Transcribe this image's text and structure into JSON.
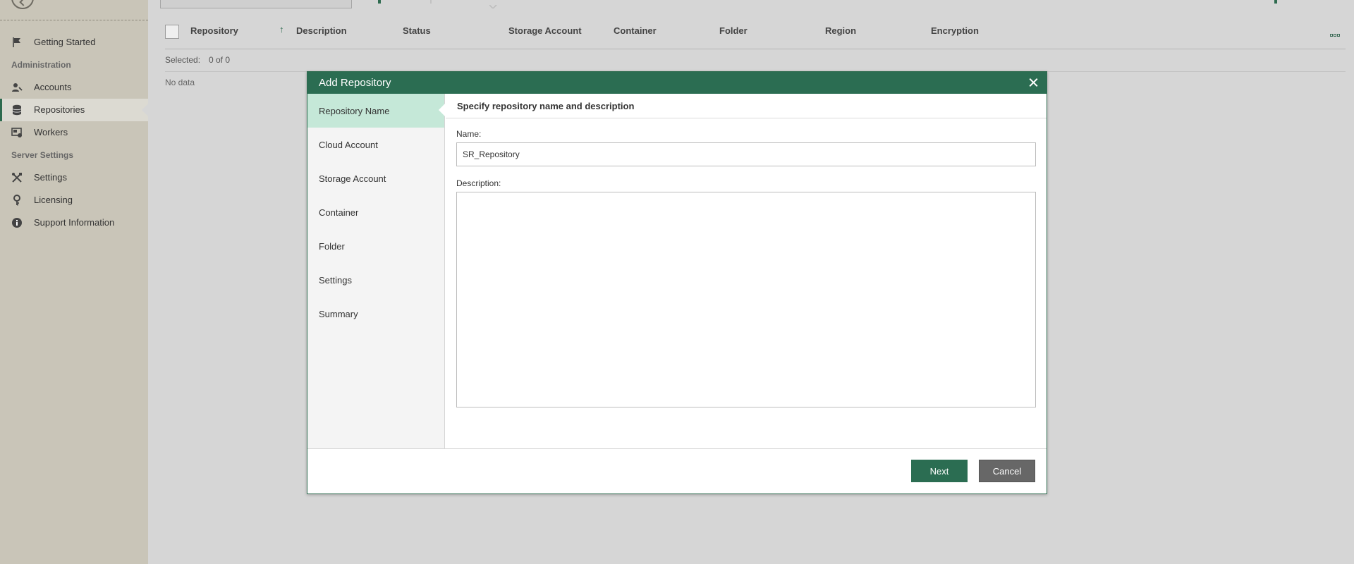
{
  "sidebar": {
    "items": [
      {
        "label": "Getting Started",
        "icon": "flag-icon"
      },
      {
        "label": "Accounts",
        "icon": "accounts-icon"
      },
      {
        "label": "Repositories",
        "icon": "database-icon"
      },
      {
        "label": "Workers",
        "icon": "workers-icon"
      },
      {
        "label": "Settings",
        "icon": "tools-icon"
      },
      {
        "label": "Licensing",
        "icon": "key-icon"
      },
      {
        "label": "Support Information",
        "icon": "info-icon"
      }
    ],
    "headers": [
      "Administration",
      "Server Settings"
    ]
  },
  "grid": {
    "columns": [
      "Repository",
      "Description",
      "Status",
      "Storage Account",
      "Container",
      "Folder",
      "Region",
      "Encryption"
    ],
    "sort_indicator": "↑",
    "selected_label": "Selected:",
    "selected_value": "0 of 0",
    "empty_text": "No data"
  },
  "dialog": {
    "title": "Add Repository",
    "steps": [
      "Repository Name",
      "Cloud Account",
      "Storage Account",
      "Container",
      "Folder",
      "Settings",
      "Summary"
    ],
    "heading": "Specify repository name and description",
    "name_label": "Name:",
    "name_value": "SR_Repository",
    "description_label": "Description:",
    "description_value": "",
    "next_label": "Next",
    "cancel_label": "Cancel"
  },
  "colors": {
    "accent": "#2b6d52",
    "active_step": "#c5e8d8",
    "sidebar_bg": "#c9c5b8"
  }
}
